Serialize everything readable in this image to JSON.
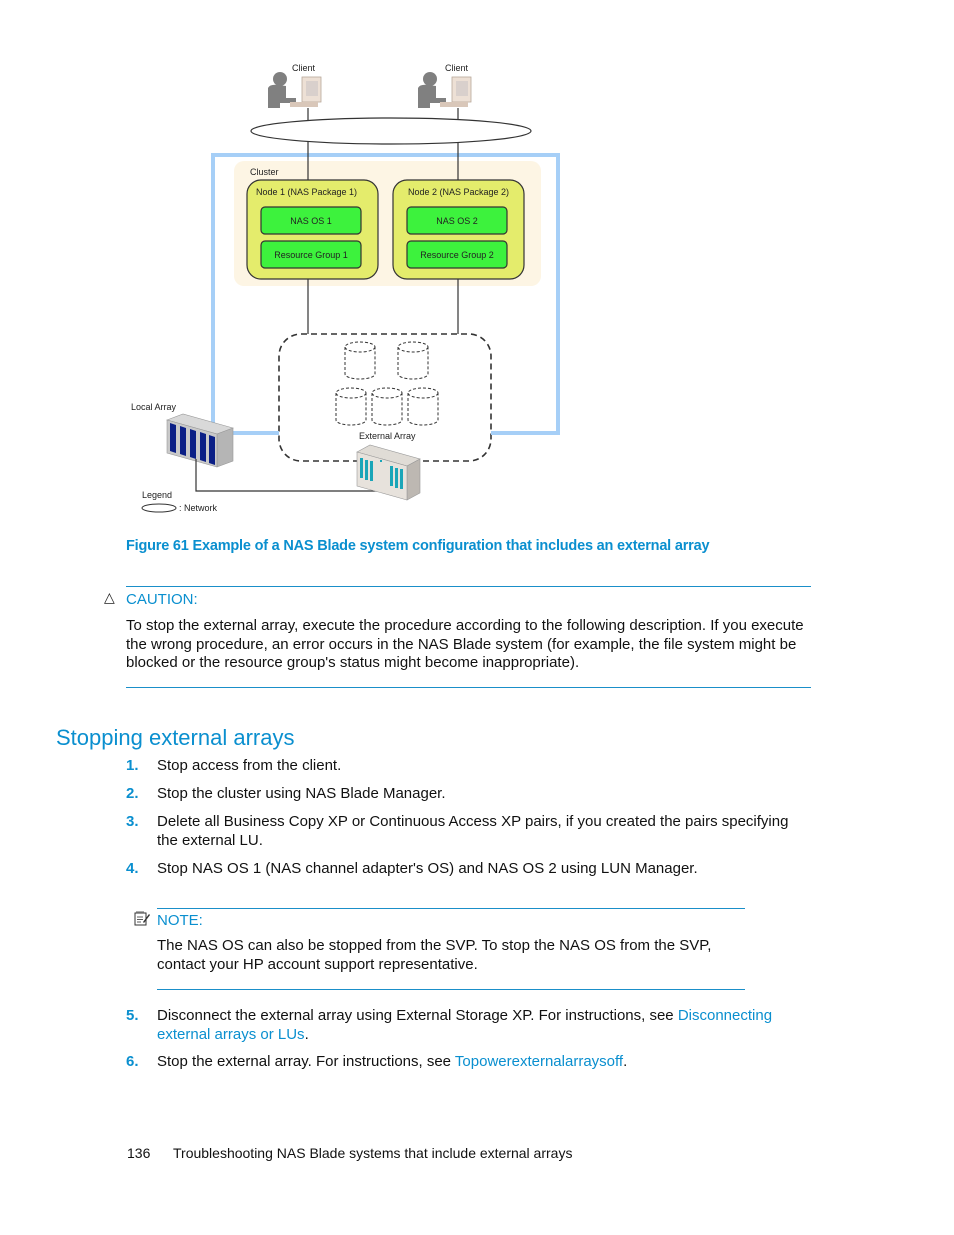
{
  "diagram": {
    "client_labels": [
      "Client",
      "Client"
    ],
    "cluster_label": "Cluster",
    "nodes": [
      {
        "label": "Node 1 (NAS Package 1)",
        "os": "NAS OS 1",
        "resource_group": "Resource Group 1"
      },
      {
        "label": "Node 2 (NAS Package 2)",
        "os": "NAS OS 2",
        "resource_group": "Resource Group 2"
      }
    ],
    "local_array_label": "Local Array",
    "external_array_label": "External Array",
    "legend_title": "Legend",
    "legend_network": ": Network",
    "colors": {
      "cluster_bg": "#fdf5e4",
      "node_fill": "#e4ec6c",
      "inner_fill": "#3df23d",
      "outer_frame": "#a6cff7",
      "array_blue": "#0b1f86",
      "array_teal": "#1aa5b8"
    }
  },
  "figure": {
    "caption": "Figure 61 Example of a NAS Blade system configuration that includes an external array"
  },
  "caution": {
    "icon": "warning-triangle-icon",
    "label": "CAUTION:",
    "text": "To stop the external array, execute the procedure according to the following description. If you execute the wrong procedure, an error occurs in the NAS Blade system (for example, the file system might be blocked or the resource group's status might become inappropriate)."
  },
  "section": {
    "title": "Stopping external arrays",
    "steps": [
      {
        "num": "1.",
        "text": "Stop access from the client."
      },
      {
        "num": "2.",
        "text": "Stop the cluster using NAS Blade Manager."
      },
      {
        "num": "3.",
        "text": "Delete all Business Copy XP or Continuous Access XP pairs, if you created the pairs specifying the external LU."
      },
      {
        "num": "4.",
        "text": "Stop NAS OS 1 (NAS channel adapter's OS) and NAS OS 2 using LUN Manager."
      },
      {
        "num": "5.",
        "text": "Disconnect the external array using External Storage XP. For instructions, see ",
        "link": "Disconnecting external arrays or LUs",
        "after": "."
      },
      {
        "num": "6.",
        "text": "Stop the external array. For instructions, see ",
        "link": "Topowerexternalarraysoff",
        "after": "."
      }
    ]
  },
  "note": {
    "icon": "note-pad-icon",
    "label": "NOTE:",
    "text": "The NAS OS can also be stopped from the SVP. To stop the NAS OS from the SVP, contact your HP account support representative."
  },
  "footer": {
    "page_number": "136",
    "title": "Troubleshooting NAS Blade systems that include external arrays"
  }
}
